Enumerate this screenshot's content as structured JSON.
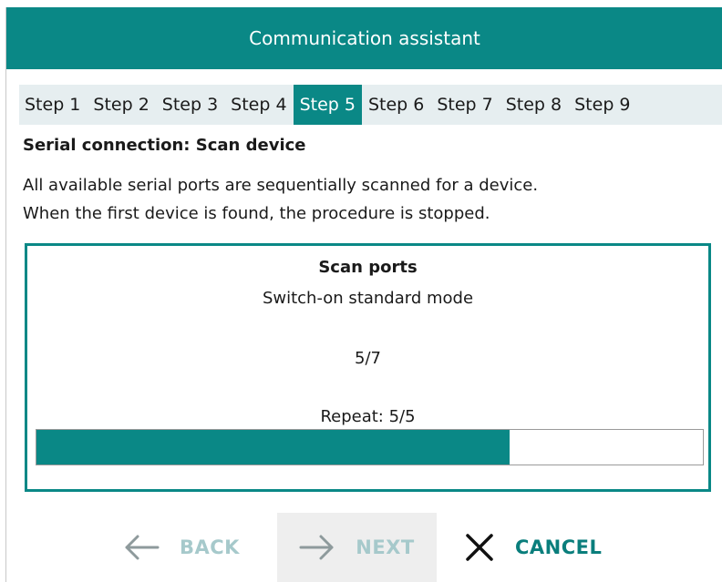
{
  "window": {
    "title": "Communication assistant"
  },
  "steps": [
    {
      "label": "Step 1",
      "active": false
    },
    {
      "label": "Step 2",
      "active": false
    },
    {
      "label": "Step 3",
      "active": false
    },
    {
      "label": "Step 4",
      "active": false
    },
    {
      "label": "Step 5",
      "active": true
    },
    {
      "label": "Step 6",
      "active": false
    },
    {
      "label": "Step 7",
      "active": false
    },
    {
      "label": "Step 8",
      "active": false
    },
    {
      "label": "Step 9",
      "active": false
    }
  ],
  "section": {
    "title": "Serial connection: Scan device",
    "description_line1": "All available serial ports are sequentially scanned for a device.",
    "description_line2": "When the first device is found, the procedure is stopped."
  },
  "scan": {
    "title": "Scan ports",
    "mode": "Switch-on standard mode",
    "count": "5/7",
    "repeat": "Repeat: 5/5",
    "progress_fraction": 0.71
  },
  "buttons": {
    "back": "BACK",
    "next": "NEXT",
    "cancel": "CANCEL"
  },
  "icons": {
    "back": "arrow-left-icon",
    "next": "arrow-right-icon",
    "cancel": "close-icon"
  },
  "colors": {
    "accent": "#0a8886",
    "disabled_text": "#a6c9cb"
  }
}
